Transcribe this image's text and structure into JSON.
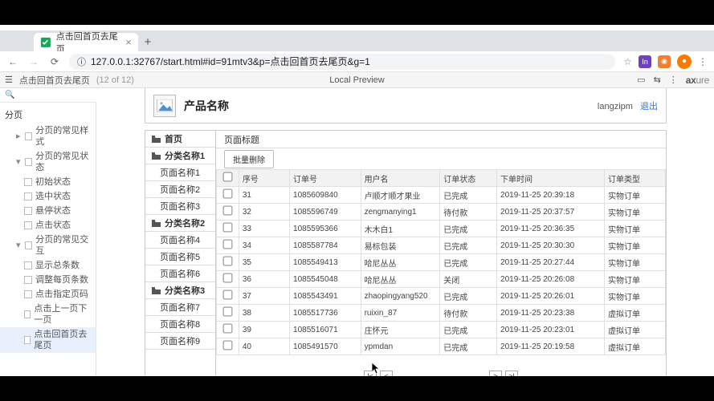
{
  "window": {
    "tab_title": "点击回首页去尾页",
    "url": "127.0.0.1:32767/start.html#id=91mtv3&p=点击回首页去尾页&g=1"
  },
  "axure": {
    "page_title": "点击回首页去尾页",
    "page_pos": "(12 of 12)",
    "center_label": "Local Preview",
    "brand": "axure"
  },
  "tree": {
    "root": "分页",
    "group1": "分页的常见样式",
    "group2": "分页的常见状态",
    "g2_items": [
      "初始状态",
      "选中状态",
      "悬停状态",
      "点击状态"
    ],
    "group3": "分页的常见交互",
    "g3_items": [
      "显示总条数",
      "调整每页条数",
      "点击指定页码",
      "点击上一页下一页",
      "点击回首页去尾页"
    ]
  },
  "product": {
    "title": "产品名称",
    "username": "langzipm",
    "logout": "退出"
  },
  "sidebar": {
    "home": "首页",
    "cat1": "分类名称1",
    "cat1_pages": [
      "页面名称1",
      "页面名称2",
      "页面名称3"
    ],
    "cat2": "分类名称2",
    "cat2_pages": [
      "页面名称4",
      "页面名称5",
      "页面名称6"
    ],
    "cat3": "分类名称3",
    "cat3_pages": [
      "页面名称7",
      "页面名称8",
      "页面名称9"
    ]
  },
  "main": {
    "title": "页面标题",
    "batch_delete": "批量删除",
    "headers": {
      "seq": "序号",
      "order": "订单号",
      "user": "用户名",
      "status": "订单状态",
      "time": "下单时间",
      "type": "订单类型"
    },
    "rows": [
      {
        "seq": "31",
        "order": "1085609840",
        "user": "卢顺才顺才果业",
        "status": "已完成",
        "time": "2019-11-25 20:39:18",
        "type": "实物订单"
      },
      {
        "seq": "32",
        "order": "1085596749",
        "user": "zengmanying1",
        "status": "待付款",
        "time": "2019-11-25 20:37:57",
        "type": "实物订单"
      },
      {
        "seq": "33",
        "order": "1085595366",
        "user": "木木白1",
        "status": "已完成",
        "time": "2019-11-25 20:36:35",
        "type": "实物订单"
      },
      {
        "seq": "34",
        "order": "1085587784",
        "user": "易标包装",
        "status": "已完成",
        "time": "2019-11-25 20:30:30",
        "type": "实物订单"
      },
      {
        "seq": "35",
        "order": "1085549413",
        "user": "哈尼丛丛",
        "status": "已完成",
        "time": "2019-11-25 20:27:44",
        "type": "实物订单"
      },
      {
        "seq": "36",
        "order": "1085545048",
        "user": "哈尼丛丛",
        "status": "关闭",
        "time": "2019-11-25 20:26:08",
        "type": "实物订单"
      },
      {
        "seq": "37",
        "order": "1085543491",
        "user": "zhaopingyang520",
        "status": "已完成",
        "time": "2019-11-25 20:26:01",
        "type": "实物订单"
      },
      {
        "seq": "38",
        "order": "1085517736",
        "user": "ruixin_87",
        "status": "待付款",
        "time": "2019-11-25 20:23:38",
        "type": "虚拟订单"
      },
      {
        "seq": "39",
        "order": "1085516071",
        "user": "庄怀元",
        "status": "已完成",
        "time": "2019-11-25 20:23:01",
        "type": "虚拟订单"
      },
      {
        "seq": "40",
        "order": "1085491570",
        "user": "ypmdan",
        "status": "已完成",
        "time": "2019-11-25 20:19:58",
        "type": "虚拟订单"
      }
    ],
    "pager": {
      "first": "|<",
      "prev": "<",
      "next": ">",
      "last": ">|"
    }
  }
}
